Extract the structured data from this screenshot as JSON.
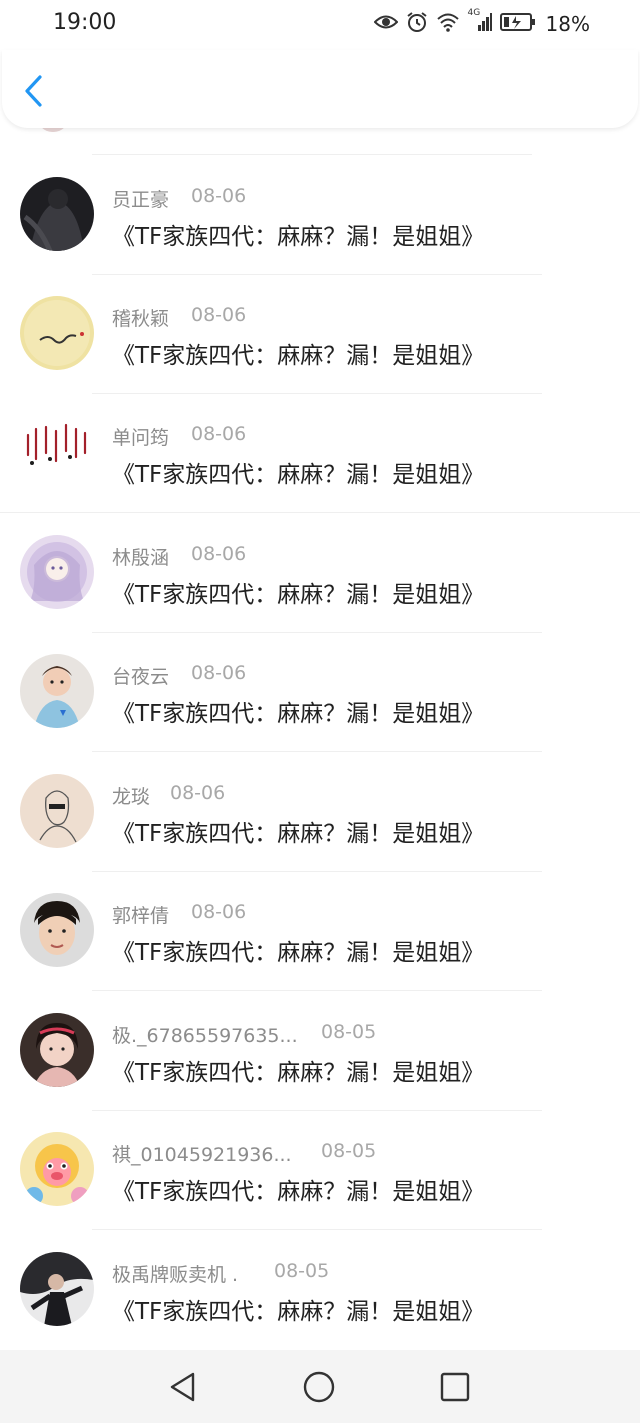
{
  "status_bar": {
    "time": "19:00",
    "battery_percent": "18%",
    "network_label": "4G",
    "icons": [
      "eye-icon",
      "alarm-icon",
      "wifi-icon",
      "signal-icon",
      "battery-icon"
    ]
  },
  "header": {
    "back_icon": "chevron-left-icon",
    "accent_color": "#2196f3"
  },
  "comments": [
    {
      "name": "员正豪",
      "date": "08-06",
      "text": "《TF家族四代：麻麻？漏！是姐姐》",
      "avatar": "dark-figure-avatar"
    },
    {
      "name": "稽秋颖",
      "date": "08-06",
      "text": "《TF家族四代：麻麻？漏！是姐姐》",
      "avatar": "yellow-handwriting-avatar"
    },
    {
      "name": "单问筠",
      "date": "08-06",
      "text": "《TF家族四代：麻麻？漏！是姐姐》",
      "avatar": "calligraphy-avatar"
    },
    {
      "name": "林殷涵",
      "date": "08-06",
      "text": "《TF家族四代：麻麻？漏！是姐姐》",
      "avatar": "anime-girl-avatar"
    },
    {
      "name": "台夜云",
      "date": "08-06",
      "text": "《TF家族四代：麻麻？漏！是姐姐》",
      "avatar": "child-photo-avatar"
    },
    {
      "name": "龙琰",
      "date": "08-06",
      "text": "《TF家族四代：麻麻？漏！是姐姐》",
      "avatar": "sketch-avatar"
    },
    {
      "name": "郭梓倩",
      "date": "08-06",
      "text": "《TF家族四代：麻麻？漏！是姐姐》",
      "avatar": "man-portrait-avatar"
    },
    {
      "name": "极._67865597635...",
      "date": "08-05",
      "text": "《TF家族四代：麻麻？漏！是姐姐》",
      "avatar": "girl-portrait-avatar"
    },
    {
      "name": "祺_01045921936...",
      "date": "08-05",
      "text": "《TF家族四代：麻麻？漏！是姐姐》",
      "avatar": "cartoon-toy-avatar"
    },
    {
      "name": "极禹牌贩卖机 .",
      "date": "08-05",
      "text": "《TF家族四代：麻麻？漏！是姐姐》",
      "avatar": "dancer-avatar"
    }
  ],
  "system_nav": {
    "back": "triangle-back-icon",
    "home": "circle-home-icon",
    "recents": "square-recents-icon"
  }
}
